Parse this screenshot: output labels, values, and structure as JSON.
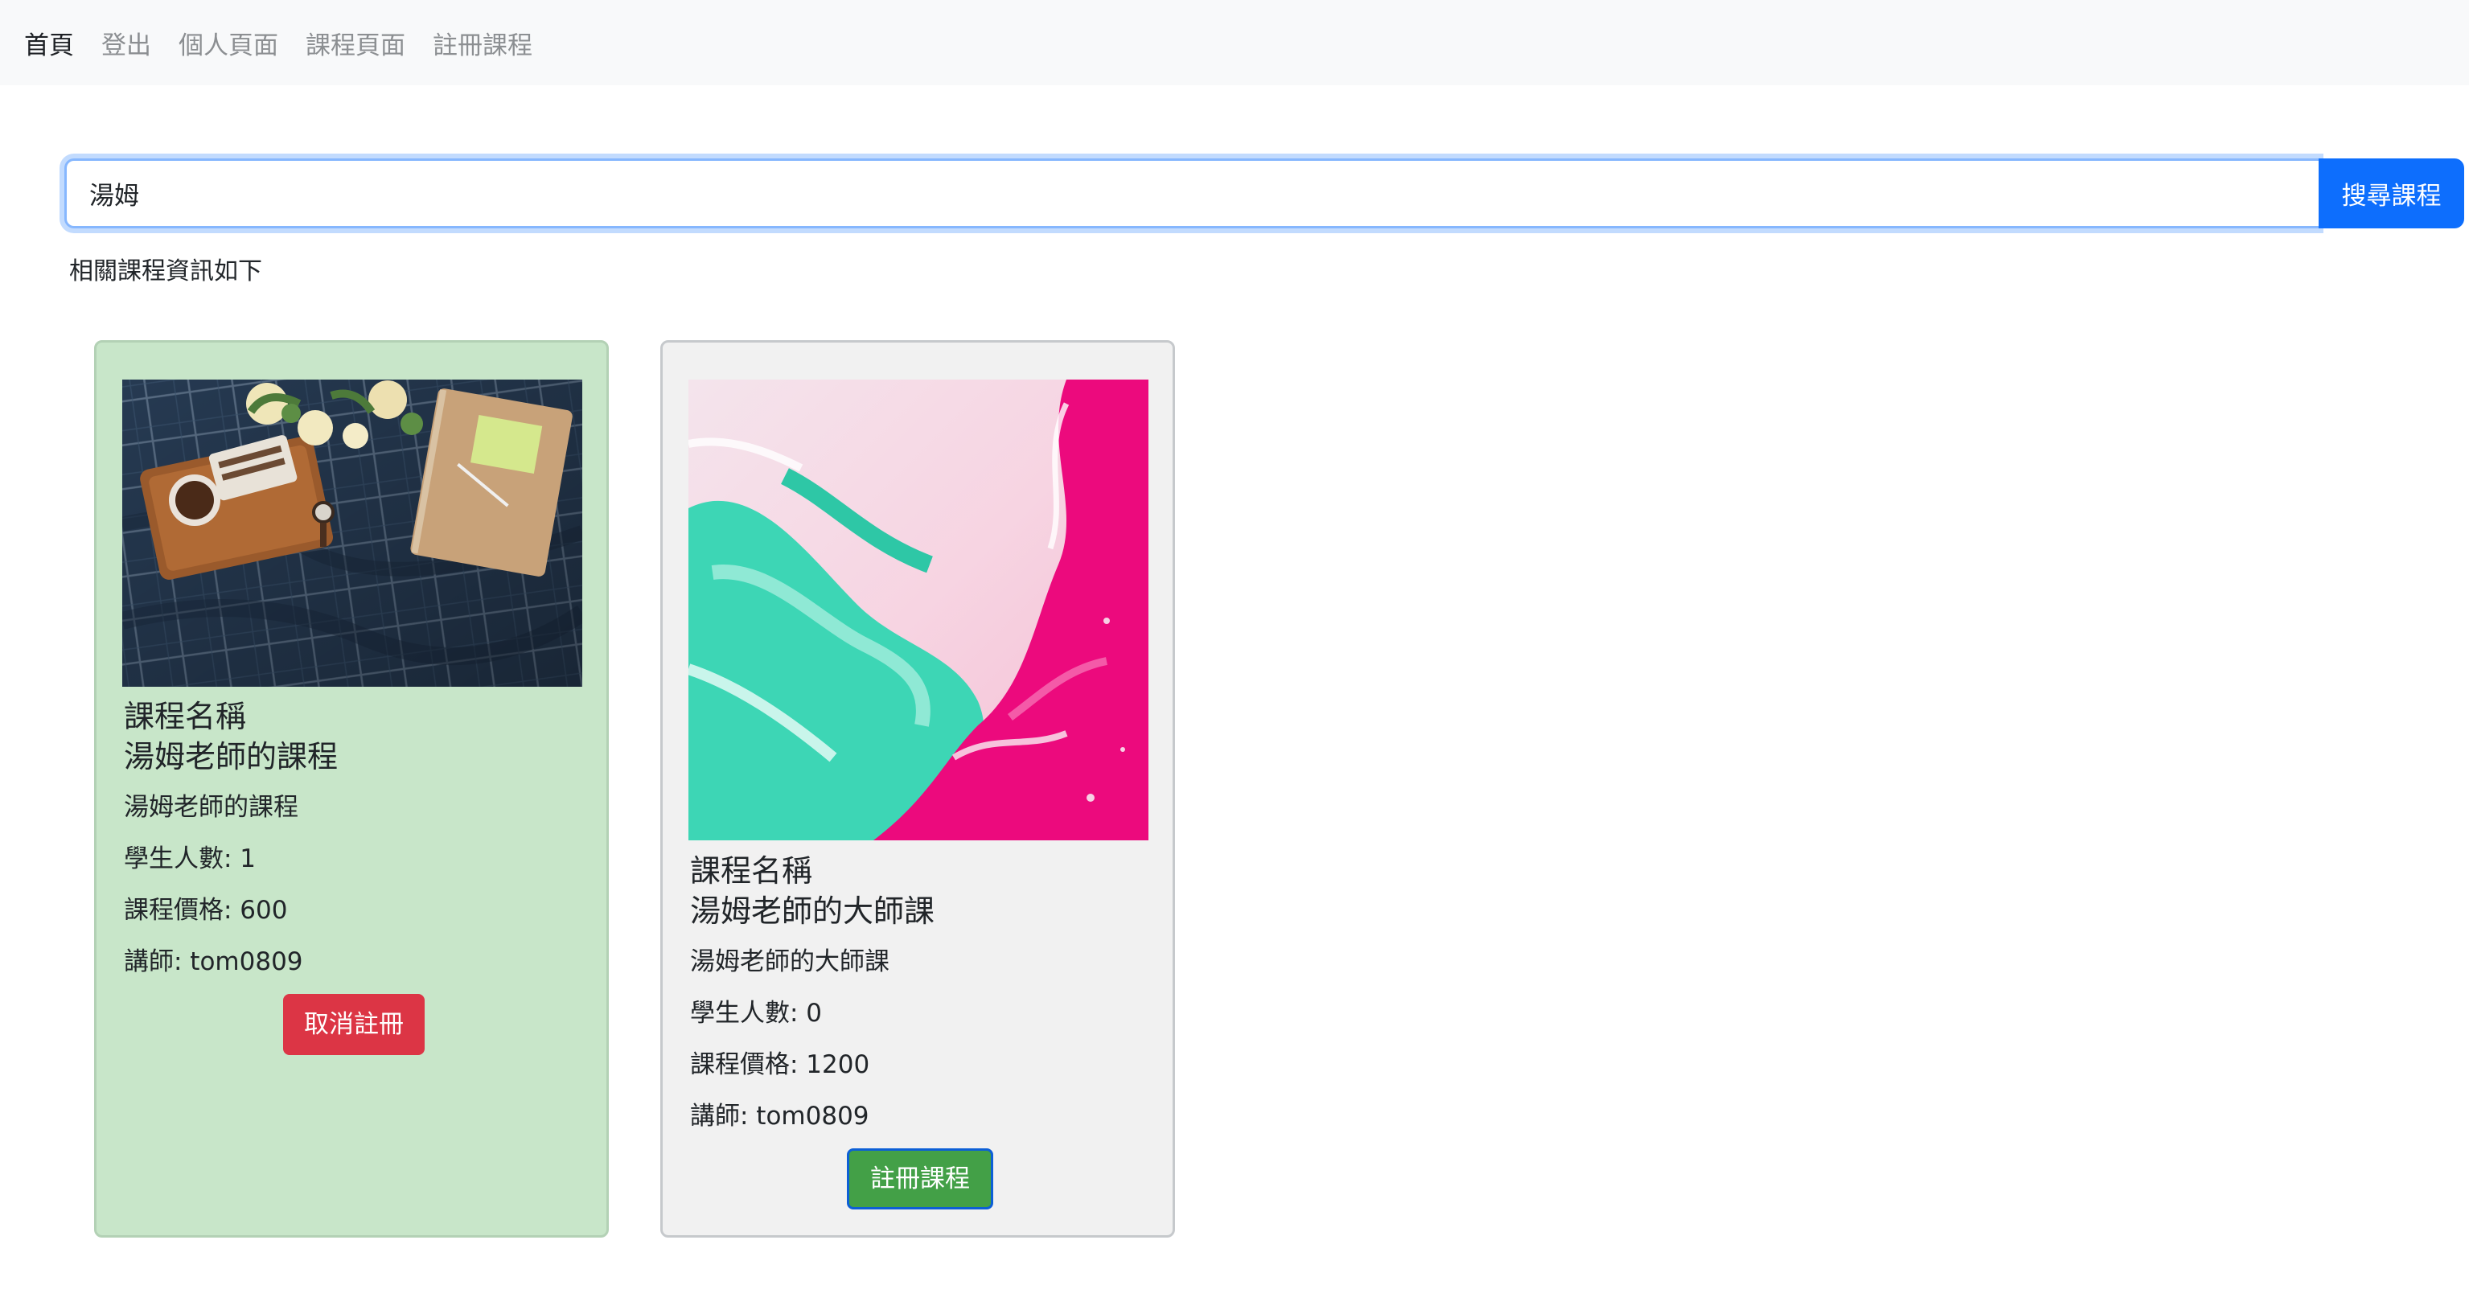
{
  "nav": {
    "home": "首頁",
    "logout": "登出",
    "profile": "個人頁面",
    "courses": "課程頁面",
    "enroll": "註冊課程"
  },
  "search": {
    "value": "湯姆",
    "button_label": "搜尋課程"
  },
  "results_text": "相關課程資訊如下",
  "courses": [
    {
      "title_label": "課程名稱",
      "title": "湯姆老師的課程",
      "description": "湯姆老師的課程",
      "students": "學生人數: 1",
      "price": "課程價格: 600",
      "instructor": "講師: tom0809",
      "button_label": "取消註冊"
    },
    {
      "title_label": "課程名稱",
      "title": "湯姆老師的大師課",
      "description": "湯姆老師的大師課",
      "students": "學生人數: 0",
      "price": "課程價格: 1200",
      "instructor": "講師: tom0809",
      "button_label": "註冊課程"
    }
  ],
  "colors": {
    "primary": "#0d6efd",
    "danger": "#dc3545",
    "success": "#43a047",
    "enrolled_card": "#c8e6c9",
    "card_default": "#f1f1f1"
  }
}
